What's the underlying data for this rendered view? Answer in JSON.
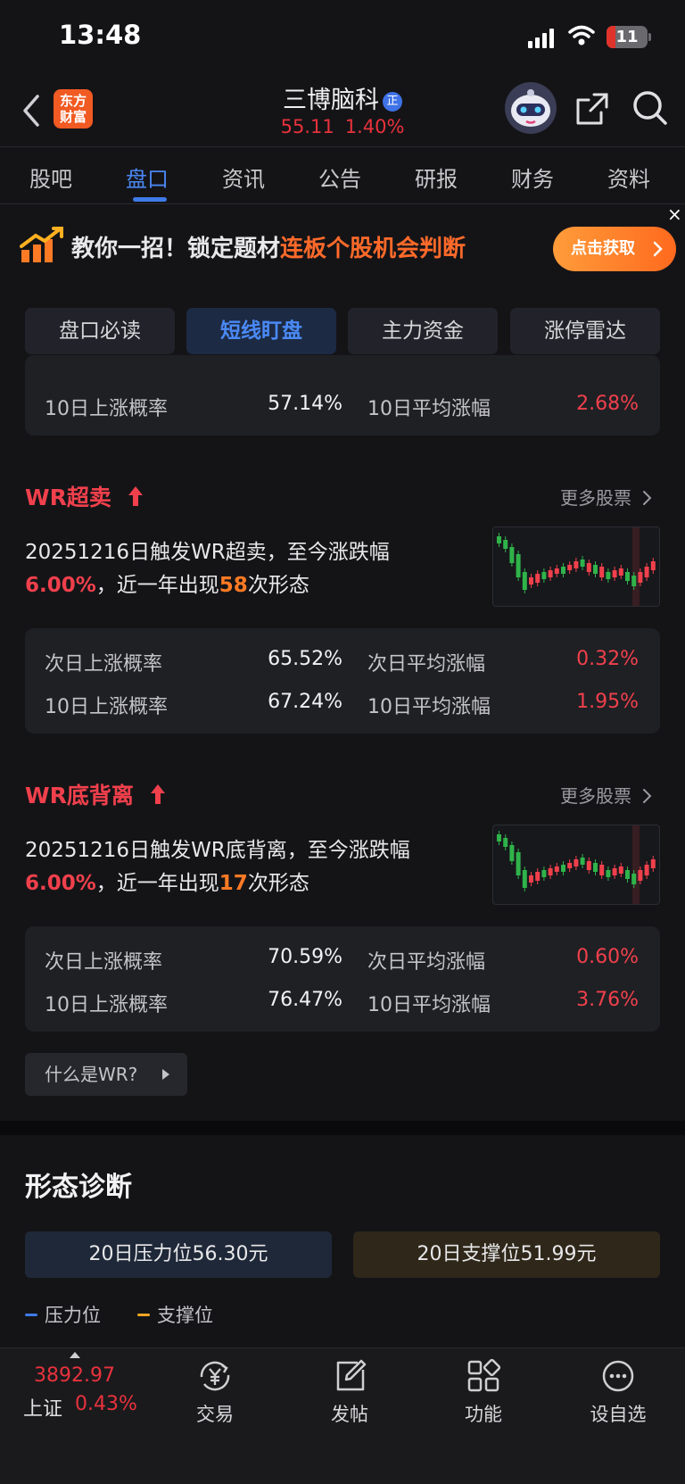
{
  "status_bar": {
    "time": "13:48",
    "battery": "11"
  },
  "header": {
    "logo_line1": "东方",
    "logo_line2": "财富",
    "stock_name": "三博脑科",
    "badge": "正",
    "price": "55.11",
    "change_pct": "1.40%"
  },
  "tabs": [
    {
      "label": "股吧"
    },
    {
      "label": "盘口"
    },
    {
      "label": "资讯"
    },
    {
      "label": "公告"
    },
    {
      "label": "研报"
    },
    {
      "label": "财务"
    },
    {
      "label": "资料"
    }
  ],
  "active_tab": "盘口",
  "banner": {
    "text_a": "教你一招！锁定题材",
    "text_b": "连板个股机会判断",
    "button": "点击获取",
    "close": "×"
  },
  "segments": [
    {
      "label": "盘口必读"
    },
    {
      "label": "短线盯盘"
    },
    {
      "label": "主力资金"
    },
    {
      "label": "涨停雷达"
    }
  ],
  "top_partial": {
    "row": {
      "label_1": "10日上涨概率",
      "value_1": "57.14%",
      "label_2": "10日平均涨幅",
      "value_2": "2.68%"
    }
  },
  "sections": [
    {
      "title": "WR超卖",
      "more": "更多股票",
      "desc_a": "20251216日触发WR超卖，至今涨跌幅",
      "pct": "6.00%",
      "desc_b": "，近一年出现",
      "count": "58",
      "desc_c": "次形态",
      "rows": [
        {
          "label_1": "次日上涨概率",
          "value_1": "65.52%",
          "label_2": "次日平均涨幅",
          "value_2": "0.32%"
        },
        {
          "label_1": "10日上涨概率",
          "value_1": "67.24%",
          "label_2": "10日平均涨幅",
          "value_2": "1.95%"
        }
      ]
    },
    {
      "title": "WR底背离",
      "more": "更多股票",
      "desc_a": "20251216日触发WR底背离，至今涨跌幅",
      "pct": "6.00%",
      "desc_b": "，近一年出现",
      "count": "17",
      "desc_c": "次形态",
      "rows": [
        {
          "label_1": "次日上涨概率",
          "value_1": "70.59%",
          "label_2": "次日平均涨幅",
          "value_2": "0.60%"
        },
        {
          "label_1": "10日上涨概率",
          "value_1": "76.47%",
          "label_2": "10日平均涨幅",
          "value_2": "3.76%"
        }
      ]
    }
  ],
  "wr_help": "什么是WR?",
  "diagnosis": {
    "title": "形态诊断",
    "pressure": "20日压力位56.30元",
    "support": "20日支撑位51.99元",
    "legend_pressure": "压力位",
    "legend_support": "支撑位"
  },
  "bottom_nav": {
    "index_value": "3892.97",
    "index_name": "上证",
    "index_pct": "0.43%",
    "items": [
      {
        "label": "交易",
        "icon": "yen-exchange-icon"
      },
      {
        "label": "发帖",
        "icon": "edit-post-icon"
      },
      {
        "label": "功能",
        "icon": "grid-function-icon"
      },
      {
        "label": "设自选",
        "icon": "more-dots-icon"
      }
    ]
  },
  "colors": {
    "up_red": "#f0404c",
    "down_green": "#2fb34a",
    "accent_blue": "#4a86f0",
    "accent_orange": "#ff7a24",
    "pressure_blue": "#3e7ae8",
    "support_orange": "#f5a623"
  }
}
